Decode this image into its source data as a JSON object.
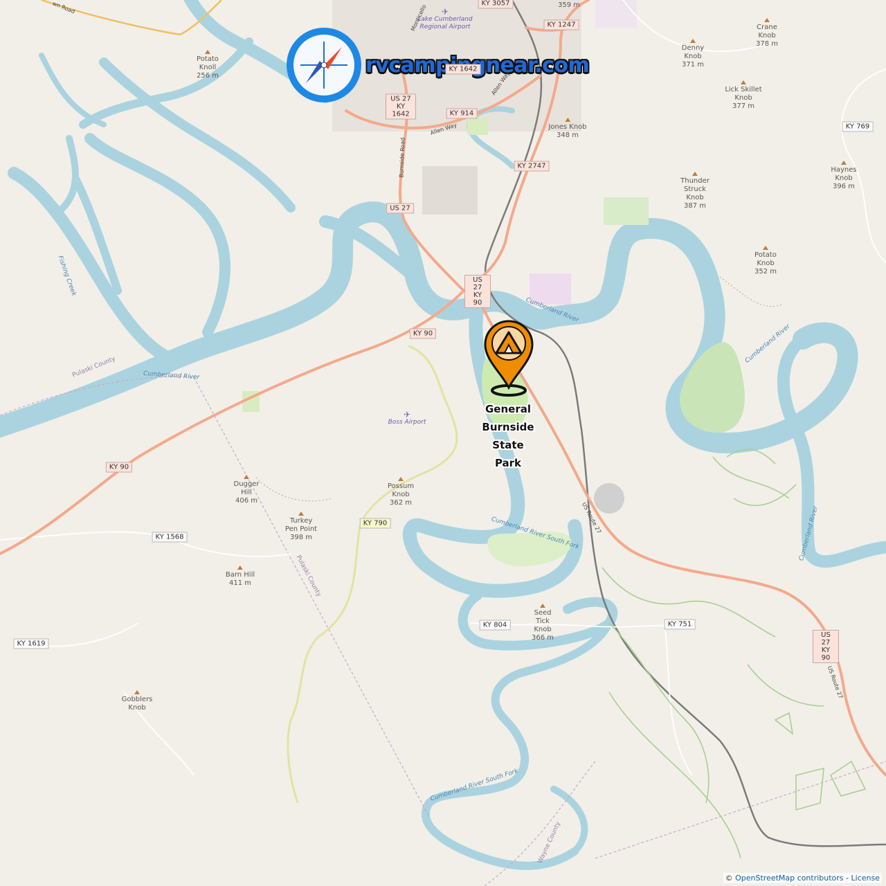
{
  "brand": {
    "logo_text": "rvcampingnear.com",
    "logo_icon": "compass-icon"
  },
  "poi": {
    "park_name_lines": [
      "General",
      "Burnside",
      "State",
      "Park"
    ],
    "marker_icon": "campsite-pin-icon",
    "marker_color": "#f08c00"
  },
  "colors": {
    "water": "#aad3df",
    "land": "#f2efe9",
    "primary_road": "#f4a98a",
    "secondary_road": "#f7f7b2",
    "rail": "#777777",
    "park": "#cdebb0",
    "county_line": "#c9a9c9"
  },
  "road_shields": [
    {
      "id": "ky3057",
      "label": "KY 3057"
    },
    {
      "id": "ky1247",
      "label": "KY 1247"
    },
    {
      "id": "ky1642a",
      "label": "KY 1642"
    },
    {
      "id": "us27ky1642",
      "label": "US 27 KY 1642"
    },
    {
      "id": "ky914",
      "label": "KY 914"
    },
    {
      "id": "ky2747",
      "label": "KY 2747"
    },
    {
      "id": "us27a",
      "label": "US 27"
    },
    {
      "id": "us27ky90a",
      "label": "US 27 KY 90"
    },
    {
      "id": "ky90a",
      "label": "KY 90"
    },
    {
      "id": "ky90b",
      "label": "KY 90"
    },
    {
      "id": "ky769",
      "label": "KY 769"
    },
    {
      "id": "ky1568",
      "label": "KY 1568"
    },
    {
      "id": "ky790",
      "label": "KY 790"
    },
    {
      "id": "ky804",
      "label": "KY 804"
    },
    {
      "id": "ky751",
      "label": "KY 751"
    },
    {
      "id": "us27ky90b",
      "label": "US 27 KY 90"
    },
    {
      "id": "ky1619",
      "label": "KY 1619"
    }
  ],
  "peaks": [
    {
      "id": "potato-knoll",
      "name": "Potato Knoll",
      "elev": "256 m"
    },
    {
      "id": "crane-knob",
      "name": "Crane Knob",
      "elev": "378 m"
    },
    {
      "id": "denny-knob",
      "name": "Denny Knob",
      "elev": "371 m"
    },
    {
      "id": "lick-skillet",
      "name": "Lick Skillet Knob",
      "elev": "377 m"
    },
    {
      "id": "jones-knob",
      "name": "Jones Knob",
      "elev": "348 m"
    },
    {
      "id": "haynes-knob",
      "name": "Haynes Knob",
      "elev": "396 m"
    },
    {
      "id": "thunder-struck",
      "name": "Thunder Struck Knob",
      "elev": "387 m"
    },
    {
      "id": "potato-knob",
      "name": "Potato Knob",
      "elev": "352 m"
    },
    {
      "id": "dugger-hill",
      "name": "Dugger Hill",
      "elev": "406 m"
    },
    {
      "id": "possum-knob",
      "name": "Possum Knob",
      "elev": "362 m"
    },
    {
      "id": "turkey-pen",
      "name": "Turkey Pen Point",
      "elev": "398 m"
    },
    {
      "id": "barn-hill",
      "name": "Barn Hill",
      "elev": "411 m"
    },
    {
      "id": "seed-tick",
      "name": "Seed Tick Knob",
      "elev": "366 m"
    },
    {
      "id": "gobblers-knob",
      "name": "Gobblers Knob",
      "elev": ""
    },
    {
      "id": "top-359",
      "name": "",
      "elev": "359 m"
    }
  ],
  "water_labels": {
    "cumberland_1": "Cumberland River",
    "cumberland_2": "Cumberland River",
    "cumberland_3": "Cumberland River",
    "cumberland_4": "Cumberland River",
    "south_fork_1": "Cumberland River South Fork",
    "south_fork_2": "Cumberland River South Fork",
    "fishing_creek": "Fishing Creek"
  },
  "admin_labels": {
    "pulaski_1": "Pulaski County",
    "pulaski_2": "Pulaski County",
    "wayne": "Wayne County"
  },
  "road_labels": {
    "burnside_road": "Burnside Road",
    "allen_way_1": "Allen Way",
    "allen_way_2": "Allen Way",
    "us_route_27_1": "US Route 27",
    "us_route_27_2": "US Route 27",
    "monticello": "Monticello",
    "town_road": "wn Road"
  },
  "airports": {
    "lake_cumberland": "Lake Cumberland Regional Airport",
    "boss": "Boss Airport"
  },
  "attribution": {
    "prefix": "©",
    "osm": "OpenStreetMap contributors",
    "sep": "-",
    "license": "License"
  }
}
